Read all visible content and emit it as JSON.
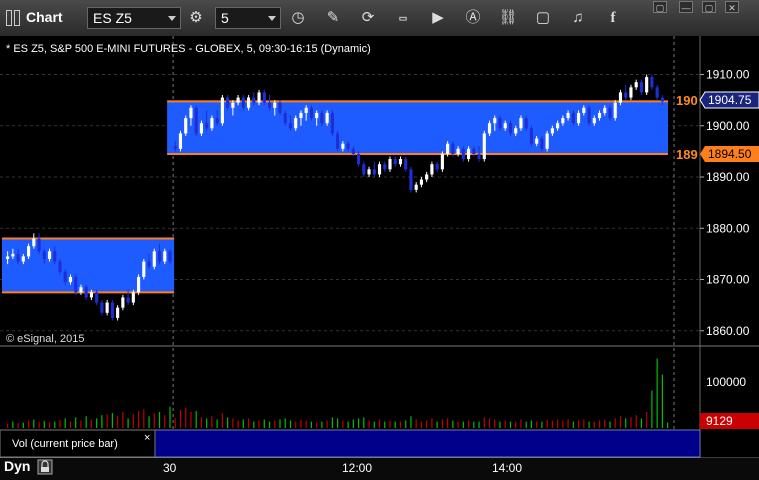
{
  "toolbar": {
    "title": "Chart",
    "symbol": "ES Z5",
    "interval": "5",
    "window_buttons": [
      "▢",
      "—",
      "▢",
      "✕"
    ]
  },
  "chart": {
    "header": "* ES Z5, S&P 500 E-MINI FUTURES - GLOBEX, 5, 09:30-16:15 (Dynamic)",
    "copyright": "© eSignal, 2015",
    "price_badges": [
      "1904.75",
      "1894.50"
    ],
    "orange_labels": [
      "190",
      "189"
    ],
    "y_axis_labels": [
      "1910.00",
      "1900.00",
      "1890.00",
      "1880.00",
      "1870.00",
      "1860.00"
    ],
    "volume_axis_label": "100000",
    "volume_badge": "9129",
    "volume_study_label": "Vol (current price bar)",
    "volume_close": "×",
    "x_axis_labels": [
      "30",
      "12:00",
      "14:00"
    ],
    "bottom_label": "Dyn",
    "colors": {
      "zone": "#1f5cff",
      "zone_line": "#ff7f1a",
      "up": "#ffffff",
      "down": "#1c2fd6",
      "vol_up": "#00c000",
      "vol_down": "#c00000",
      "badge_price": "#1a237e",
      "badge_vol": "#cc0000"
    }
  },
  "chart_data": {
    "type": "candlestick",
    "ylim": [
      1858,
      1914
    ],
    "zones": [
      {
        "from_bar": 0,
        "to_bar": 32,
        "low": 1867.5,
        "high": 1878
      },
      {
        "from_bar": 32,
        "to_bar": 133,
        "low": 1894.5,
        "high": 1904.75
      }
    ],
    "session_break_bar": 32,
    "candles": [
      [
        1874,
        1875.5,
        1873,
        1874.5
      ],
      [
        1874.5,
        1876,
        1874,
        1875
      ],
      [
        1875,
        1876,
        1873,
        1873.5
      ],
      [
        1873.5,
        1875,
        1873,
        1874.5
      ],
      [
        1874.5,
        1877,
        1874,
        1876.5
      ],
      [
        1876.5,
        1879,
        1876,
        1878
      ],
      [
        1878,
        1879,
        1875,
        1875.5
      ],
      [
        1875.5,
        1876,
        1873,
        1874
      ],
      [
        1874,
        1876,
        1873.5,
        1875.5
      ],
      [
        1875.5,
        1876.5,
        1873,
        1873.5
      ],
      [
        1873.5,
        1874,
        1871,
        1871.5
      ],
      [
        1871.5,
        1872,
        1869,
        1869.5
      ],
      [
        1869.5,
        1871,
        1869,
        1870.5
      ],
      [
        1870.5,
        1871,
        1867,
        1867.5
      ],
      [
        1867.5,
        1869,
        1867,
        1868.5
      ],
      [
        1868.5,
        1869,
        1866,
        1866.5
      ],
      [
        1866.5,
        1868,
        1866,
        1867.5
      ],
      [
        1867.5,
        1868,
        1865,
        1865.5
      ],
      [
        1865.5,
        1866,
        1863,
        1863.5
      ],
      [
        1863.5,
        1866,
        1863,
        1865.5
      ],
      [
        1865.5,
        1866,
        1862,
        1862.5
      ],
      [
        1862.5,
        1865,
        1862,
        1864.5
      ],
      [
        1864.5,
        1867,
        1864,
        1866.5
      ],
      [
        1866.5,
        1868,
        1865,
        1865.5
      ],
      [
        1865.5,
        1868,
        1865,
        1867.5
      ],
      [
        1867.5,
        1871,
        1867,
        1870.5
      ],
      [
        1870.5,
        1874,
        1870,
        1873.5
      ],
      [
        1873.5,
        1875,
        1872,
        1872.5
      ],
      [
        1872.5,
        1876,
        1872,
        1875.5
      ],
      [
        1875.5,
        1877,
        1873,
        1873.5
      ],
      [
        1873.5,
        1876,
        1873,
        1875.5
      ],
      [
        1875.5,
        1876,
        1873,
        1873.5
      ],
      [
        1896,
        1897,
        1895,
        1895.5
      ],
      [
        1895.5,
        1899,
        1895,
        1898.5
      ],
      [
        1898.5,
        1902,
        1898,
        1901.5
      ],
      [
        1901.5,
        1904,
        1900,
        1903.5
      ],
      [
        1903.5,
        1904,
        1898,
        1898.5
      ],
      [
        1898.5,
        1901,
        1898,
        1900.5
      ],
      [
        1900.5,
        1903,
        1899,
        1899.5
      ],
      [
        1899.5,
        1902,
        1899,
        1901.5
      ],
      [
        1901.5,
        1903,
        1900,
        1900.5
      ],
      [
        1900.5,
        1906,
        1900,
        1905.5
      ],
      [
        1905.5,
        1906,
        1903,
        1903.5
      ],
      [
        1903.5,
        1905,
        1902,
        1904.5
      ],
      [
        1904.5,
        1906,
        1904,
        1905.5
      ],
      [
        1905.5,
        1906,
        1903,
        1903.5
      ],
      [
        1903.5,
        1906,
        1903,
        1905.5
      ],
      [
        1905.5,
        1906.5,
        1904,
        1904.5
      ],
      [
        1904.5,
        1907,
        1904,
        1906.5
      ],
      [
        1906.5,
        1907,
        1904,
        1904.5
      ],
      [
        1904.5,
        1906,
        1903,
        1903.5
      ],
      [
        1903.5,
        1905,
        1902,
        1904.5
      ],
      [
        1904.5,
        1905,
        1902,
        1902.5
      ],
      [
        1902.5,
        1903,
        1900,
        1900.5
      ],
      [
        1900.5,
        1902,
        1899,
        1899.5
      ],
      [
        1899.5,
        1902,
        1899,
        1901.5
      ],
      [
        1901.5,
        1903,
        1900,
        1902.5
      ],
      [
        1902.5,
        1904,
        1901,
        1903.5
      ],
      [
        1903.5,
        1904,
        1901,
        1901.5
      ],
      [
        1901.5,
        1903,
        1900,
        1902.5
      ],
      [
        1902.5,
        1903,
        1900,
        1900.5
      ],
      [
        1900.5,
        1903,
        1900,
        1902.5
      ],
      [
        1902.5,
        1903,
        1898,
        1898.5
      ],
      [
        1898.5,
        1899,
        1895,
        1895.5
      ],
      [
        1895.5,
        1897,
        1895,
        1896.5
      ],
      [
        1896.5,
        1897,
        1895,
        1895.5
      ],
      [
        1895.5,
        1896,
        1894,
        1894.5
      ],
      [
        1894.5,
        1895,
        1892,
        1892.5
      ],
      [
        1892.5,
        1893,
        1890,
        1890.5
      ],
      [
        1890.5,
        1892,
        1890,
        1891.5
      ],
      [
        1891.5,
        1893,
        1890,
        1890.5
      ],
      [
        1890.5,
        1893,
        1890,
        1892.5
      ],
      [
        1892.5,
        1893,
        1891,
        1891.5
      ],
      [
        1891.5,
        1894,
        1891,
        1893.5
      ],
      [
        1893.5,
        1894,
        1892,
        1892.5
      ],
      [
        1892.5,
        1894,
        1892,
        1893.5
      ],
      [
        1893.5,
        1894,
        1891,
        1891.5
      ],
      [
        1891.5,
        1892,
        1887,
        1887.5
      ],
      [
        1887.5,
        1889,
        1887,
        1888.5
      ],
      [
        1888.5,
        1890,
        1888,
        1889.5
      ],
      [
        1889.5,
        1891,
        1889,
        1890.5
      ],
      [
        1890.5,
        1893,
        1890,
        1892.5
      ],
      [
        1892.5,
        1893,
        1891,
        1891.5
      ],
      [
        1891.5,
        1895,
        1891,
        1894.5
      ],
      [
        1894.5,
        1897,
        1894,
        1896.5
      ],
      [
        1896.5,
        1897,
        1894,
        1894.5
      ],
      [
        1894.5,
        1896,
        1894,
        1895.5
      ],
      [
        1895.5,
        1896,
        1893,
        1893.5
      ],
      [
        1893.5,
        1896,
        1893,
        1895.5
      ],
      [
        1895.5,
        1896,
        1894,
        1894.5
      ],
      [
        1894.5,
        1896,
        1893,
        1893.5
      ],
      [
        1893.5,
        1899,
        1893,
        1898.5
      ],
      [
        1898.5,
        1901,
        1898,
        1900.5
      ],
      [
        1900.5,
        1902,
        1899,
        1901.5
      ],
      [
        1901.5,
        1902,
        1899,
        1899.5
      ],
      [
        1899.5,
        1901,
        1899,
        1900.5
      ],
      [
        1900.5,
        1901,
        1898,
        1898.5
      ],
      [
        1898.5,
        1900,
        1898,
        1899.5
      ],
      [
        1899.5,
        1902,
        1899,
        1901.5
      ],
      [
        1901.5,
        1902,
        1899,
        1899.5
      ],
      [
        1899.5,
        1900,
        1896,
        1896.5
      ],
      [
        1896.5,
        1898,
        1896,
        1897.5
      ],
      [
        1897.5,
        1898,
        1895,
        1895.5
      ],
      [
        1895.5,
        1899,
        1895,
        1898.5
      ],
      [
        1898.5,
        1900,
        1898,
        1899.5
      ],
      [
        1899.5,
        1901,
        1899,
        1900.5
      ],
      [
        1900.5,
        1902,
        1900,
        1901.5
      ],
      [
        1901.5,
        1903,
        1901,
        1902.5
      ],
      [
        1902.5,
        1903,
        1900,
        1900.5
      ],
      [
        1900.5,
        1903,
        1900,
        1902.5
      ],
      [
        1902.5,
        1904,
        1902,
        1903.5
      ],
      [
        1903.5,
        1904,
        1900,
        1900.5
      ],
      [
        1900.5,
        1902,
        1900,
        1901.5
      ],
      [
        1901.5,
        1903,
        1901,
        1902.5
      ],
      [
        1902.5,
        1904,
        1902,
        1903.5
      ],
      [
        1903.5,
        1904,
        1901,
        1901.5
      ],
      [
        1901.5,
        1905,
        1901,
        1904.5
      ],
      [
        1904.5,
        1907,
        1904,
        1906.5
      ],
      [
        1906.5,
        1908,
        1905,
        1905.5
      ],
      [
        1905.5,
        1908,
        1905,
        1907.5
      ],
      [
        1907.5,
        1909,
        1907,
        1908.5
      ],
      [
        1908.5,
        1909,
        1906,
        1906.5
      ],
      [
        1906.5,
        1910,
        1906,
        1909.5
      ],
      [
        1909.5,
        1910,
        1907,
        1907.5
      ],
      [
        1907.5,
        1908,
        1905,
        1905.5
      ],
      [
        1905.5,
        1906,
        1904,
        1904.75
      ]
    ],
    "volume": [
      [
        8,
        0
      ],
      [
        12,
        1
      ],
      [
        9,
        0
      ],
      [
        10,
        1
      ],
      [
        14,
        0
      ],
      [
        16,
        1
      ],
      [
        11,
        0
      ],
      [
        13,
        1
      ],
      [
        10,
        0
      ],
      [
        12,
        1
      ],
      [
        15,
        0
      ],
      [
        18,
        1
      ],
      [
        12,
        0
      ],
      [
        20,
        1
      ],
      [
        14,
        0
      ],
      [
        22,
        1
      ],
      [
        16,
        0
      ],
      [
        18,
        1
      ],
      [
        24,
        1
      ],
      [
        26,
        0
      ],
      [
        28,
        1
      ],
      [
        22,
        0
      ],
      [
        30,
        0
      ],
      [
        18,
        1
      ],
      [
        26,
        0
      ],
      [
        32,
        0
      ],
      [
        35,
        0
      ],
      [
        22,
        1
      ],
      [
        28,
        0
      ],
      [
        30,
        1
      ],
      [
        24,
        0
      ],
      [
        40,
        1
      ],
      [
        18,
        0
      ],
      [
        34,
        0
      ],
      [
        38,
        0
      ],
      [
        30,
        0
      ],
      [
        32,
        1
      ],
      [
        20,
        0
      ],
      [
        18,
        1
      ],
      [
        22,
        0
      ],
      [
        16,
        1
      ],
      [
        28,
        0
      ],
      [
        20,
        1
      ],
      [
        18,
        0
      ],
      [
        14,
        0
      ],
      [
        16,
        1
      ],
      [
        18,
        0
      ],
      [
        12,
        1
      ],
      [
        14,
        0
      ],
      [
        16,
        1
      ],
      [
        12,
        1
      ],
      [
        14,
        0
      ],
      [
        16,
        1
      ],
      [
        18,
        1
      ],
      [
        14,
        1
      ],
      [
        12,
        0
      ],
      [
        16,
        0
      ],
      [
        14,
        0
      ],
      [
        12,
        1
      ],
      [
        10,
        0
      ],
      [
        12,
        1
      ],
      [
        14,
        0
      ],
      [
        20,
        1
      ],
      [
        18,
        1
      ],
      [
        14,
        0
      ],
      [
        12,
        1
      ],
      [
        16,
        1
      ],
      [
        18,
        1
      ],
      [
        20,
        1
      ],
      [
        14,
        0
      ],
      [
        12,
        1
      ],
      [
        16,
        0
      ],
      [
        12,
        1
      ],
      [
        14,
        0
      ],
      [
        12,
        1
      ],
      [
        12,
        0
      ],
      [
        14,
        1
      ],
      [
        22,
        1
      ],
      [
        16,
        0
      ],
      [
        12,
        0
      ],
      [
        14,
        0
      ],
      [
        18,
        0
      ],
      [
        12,
        1
      ],
      [
        16,
        0
      ],
      [
        18,
        0
      ],
      [
        14,
        1
      ],
      [
        12,
        0
      ],
      [
        12,
        1
      ],
      [
        14,
        0
      ],
      [
        12,
        1
      ],
      [
        12,
        1
      ],
      [
        20,
        0
      ],
      [
        18,
        0
      ],
      [
        16,
        0
      ],
      [
        12,
        1
      ],
      [
        14,
        0
      ],
      [
        12,
        1
      ],
      [
        12,
        0
      ],
      [
        16,
        0
      ],
      [
        12,
        1
      ],
      [
        14,
        1
      ],
      [
        12,
        0
      ],
      [
        12,
        1
      ],
      [
        16,
        0
      ],
      [
        14,
        0
      ],
      [
        16,
        0
      ],
      [
        14,
        0
      ],
      [
        16,
        0
      ],
      [
        12,
        1
      ],
      [
        14,
        0
      ],
      [
        16,
        0
      ],
      [
        12,
        1
      ],
      [
        12,
        0
      ],
      [
        14,
        0
      ],
      [
        16,
        0
      ],
      [
        12,
        1
      ],
      [
        18,
        0
      ],
      [
        22,
        0
      ],
      [
        18,
        1
      ],
      [
        20,
        0
      ],
      [
        24,
        0
      ],
      [
        18,
        1
      ],
      [
        30,
        0
      ],
      [
        70,
        1
      ],
      [
        130,
        1
      ],
      [
        100,
        1
      ],
      [
        10,
        1
      ]
    ],
    "volume_scale_max": 150
  }
}
